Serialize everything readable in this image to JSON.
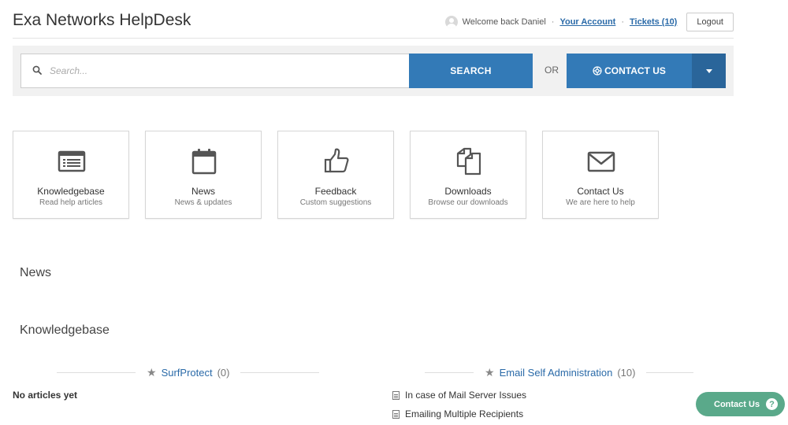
{
  "header": {
    "title": "Exa Networks HelpDesk",
    "welcome": "Welcome back Daniel",
    "separator": "·",
    "account_link": "Your Account",
    "tickets_link": "Tickets (10)",
    "logout_label": "Logout"
  },
  "search": {
    "placeholder": "Search...",
    "button_label": "SEARCH",
    "or_label": "OR",
    "contact_label": "CONTACT US"
  },
  "tiles": [
    {
      "title": "Knowledgebase",
      "subtitle": "Read help articles",
      "icon": "knowledgebase-icon"
    },
    {
      "title": "News",
      "subtitle": "News & updates",
      "icon": "calendar-icon"
    },
    {
      "title": "Feedback",
      "subtitle": "Custom suggestions",
      "icon": "thumbs-up-icon"
    },
    {
      "title": "Downloads",
      "subtitle": "Browse our downloads",
      "icon": "documents-icon"
    },
    {
      "title": "Contact Us",
      "subtitle": "We are here to help",
      "icon": "envelope-icon"
    }
  ],
  "sections": {
    "news_heading": "News",
    "kb_heading": "Knowledgebase"
  },
  "kb": {
    "left": {
      "category": "SurfProtect",
      "count": "(0)",
      "empty": "No articles yet"
    },
    "right": {
      "category": "Email Self Administration",
      "count": "(10)",
      "articles": [
        "In case of Mail Server Issues",
        "Emailing Multiple Recipients"
      ]
    }
  },
  "floating": {
    "label": "Contact Us",
    "icon_glyph": "?"
  },
  "colors": {
    "primary": "#337ab7",
    "primary_dark": "#2a659a",
    "link": "#2a6aa8",
    "float_green": "#5aa98a"
  }
}
